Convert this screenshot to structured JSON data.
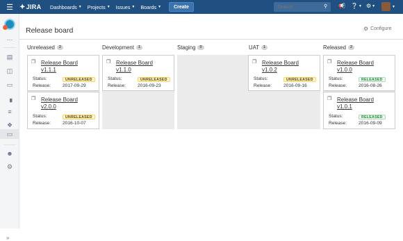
{
  "topbar": {
    "logo": "JIRA",
    "nav": [
      {
        "label": "Dashboards"
      },
      {
        "label": "Projects"
      },
      {
        "label": "Issues"
      },
      {
        "label": "Boards"
      }
    ],
    "create_label": "Create",
    "search_placeholder": "Search"
  },
  "page": {
    "title": "Release board",
    "configure_label": "Configure"
  },
  "columns": [
    {
      "name": "Unreleased",
      "count": "2",
      "cards": [
        {
          "title_l1": "Release Board",
          "title_l2": "v1.1.1",
          "status_label": "Status:",
          "status": "UNRELEASED",
          "release_label": "Release:",
          "release": "2017-09-29"
        },
        {
          "title_l1": "Release Board",
          "title_l2": "v2.0.0",
          "status_label": "Status:",
          "status": "UNRELEASED",
          "release_label": "Release:",
          "release": "2016-10-07"
        }
      ]
    },
    {
      "name": "Development",
      "count": "1",
      "cards": [
        {
          "title_l1": "Release Board",
          "title_l2": "v1.1.0",
          "status_label": "Status:",
          "status": "UNRELEASED",
          "release_label": "Release:",
          "release": "2016-09-23"
        }
      ]
    },
    {
      "name": "Staging",
      "count": "0",
      "cards": []
    },
    {
      "name": "UAT",
      "count": "1",
      "cards": [
        {
          "title_l1": "Release Board",
          "title_l2": "v1.0.2",
          "status_label": "Status:",
          "status": "UNRELEASED",
          "release_label": "Release:",
          "release": "2016-09-16"
        }
      ]
    },
    {
      "name": "Released",
      "count": "2",
      "cards": [
        {
          "title_l1": "Release Board",
          "title_l2": "v1.0.0",
          "status_label": "Status:",
          "status": "RELEASED",
          "release_label": "Release:",
          "release": "2016-08-26"
        },
        {
          "title_l1": "Release Board",
          "title_l2": "v1.0.1",
          "status_label": "Status:",
          "status": "RELEASED",
          "release_label": "Release:",
          "release": "2016-09-09"
        }
      ]
    }
  ]
}
